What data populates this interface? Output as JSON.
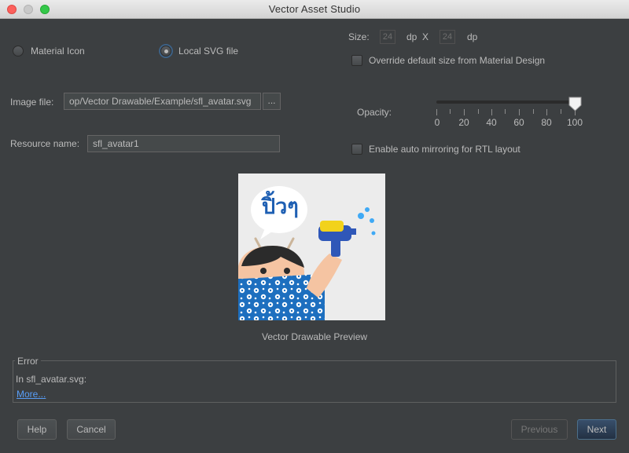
{
  "window": {
    "title": "Vector Asset Studio"
  },
  "source": {
    "material_icon_label": "Material Icon",
    "local_svg_label": "Local SVG file",
    "selected": "Local SVG file"
  },
  "size": {
    "label": "Size:",
    "width": "24",
    "width_unit": "dp",
    "separator": "X",
    "height": "24",
    "height_unit": "dp",
    "override_label": "Override default size from Material Design",
    "override_checked": false
  },
  "image_file": {
    "label": "Image file:",
    "value": "op/Vector Drawable/Example/sfl_avatar.svg",
    "browse_label": "..."
  },
  "resource": {
    "label": "Resource name:",
    "value": "sfl_avatar1"
  },
  "opacity": {
    "label": "Opacity:",
    "value": 100,
    "ticks": [
      "0",
      "20",
      "40",
      "60",
      "80",
      "100"
    ]
  },
  "auto_mirror": {
    "label": "Enable auto mirroring for RTL layout",
    "checked": false
  },
  "preview": {
    "bubble_text": "ปิ้วๆ",
    "caption": "Vector Drawable Preview"
  },
  "error": {
    "legend": "Error",
    "message": "In sfl_avatar.svg:",
    "more_link": "More..."
  },
  "buttons": {
    "help": "Help",
    "cancel": "Cancel",
    "previous": "Previous",
    "next": "Next"
  },
  "colors": {
    "background": "#3c3f41",
    "accent": "#589df6",
    "default_button": "#2f4a66"
  }
}
